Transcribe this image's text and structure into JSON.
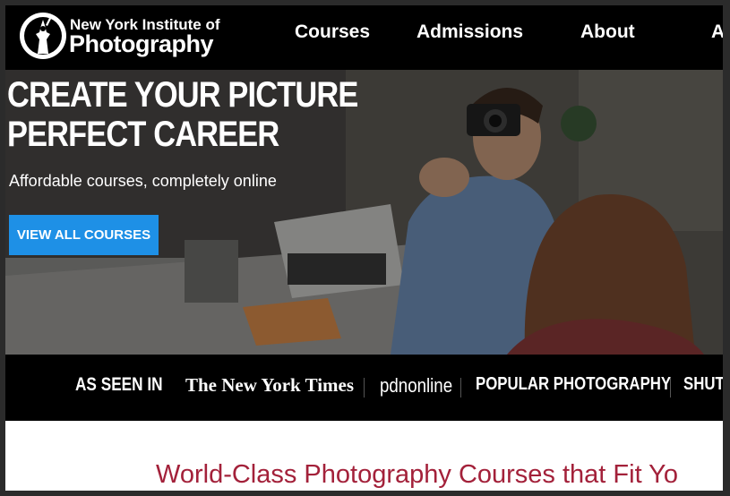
{
  "nav": {
    "logo_line1": "New York Institute of",
    "logo_line2": "Photography",
    "items": [
      {
        "label": "Courses"
      },
      {
        "label": "Admissions"
      },
      {
        "label": "About"
      },
      {
        "label": "A"
      }
    ]
  },
  "hero": {
    "title_line1": "CREATE YOUR PICTURE",
    "title_line2": "PERFECT CAREER",
    "subtitle": "Affordable courses, completely online",
    "button_label": "VIEW ALL COURSES"
  },
  "press": {
    "label": "AS SEEN IN",
    "outlets": [
      "The New York Times",
      "pdnonline",
      "POPULAR PHOTOGRAPHY",
      "SHUT"
    ]
  },
  "content": {
    "heading": "World-Class Photography Courses that Fit Yo"
  },
  "colors": {
    "accent_button": "#1e90e6",
    "heading_red": "#a3213a",
    "nav_bg": "#000000"
  }
}
